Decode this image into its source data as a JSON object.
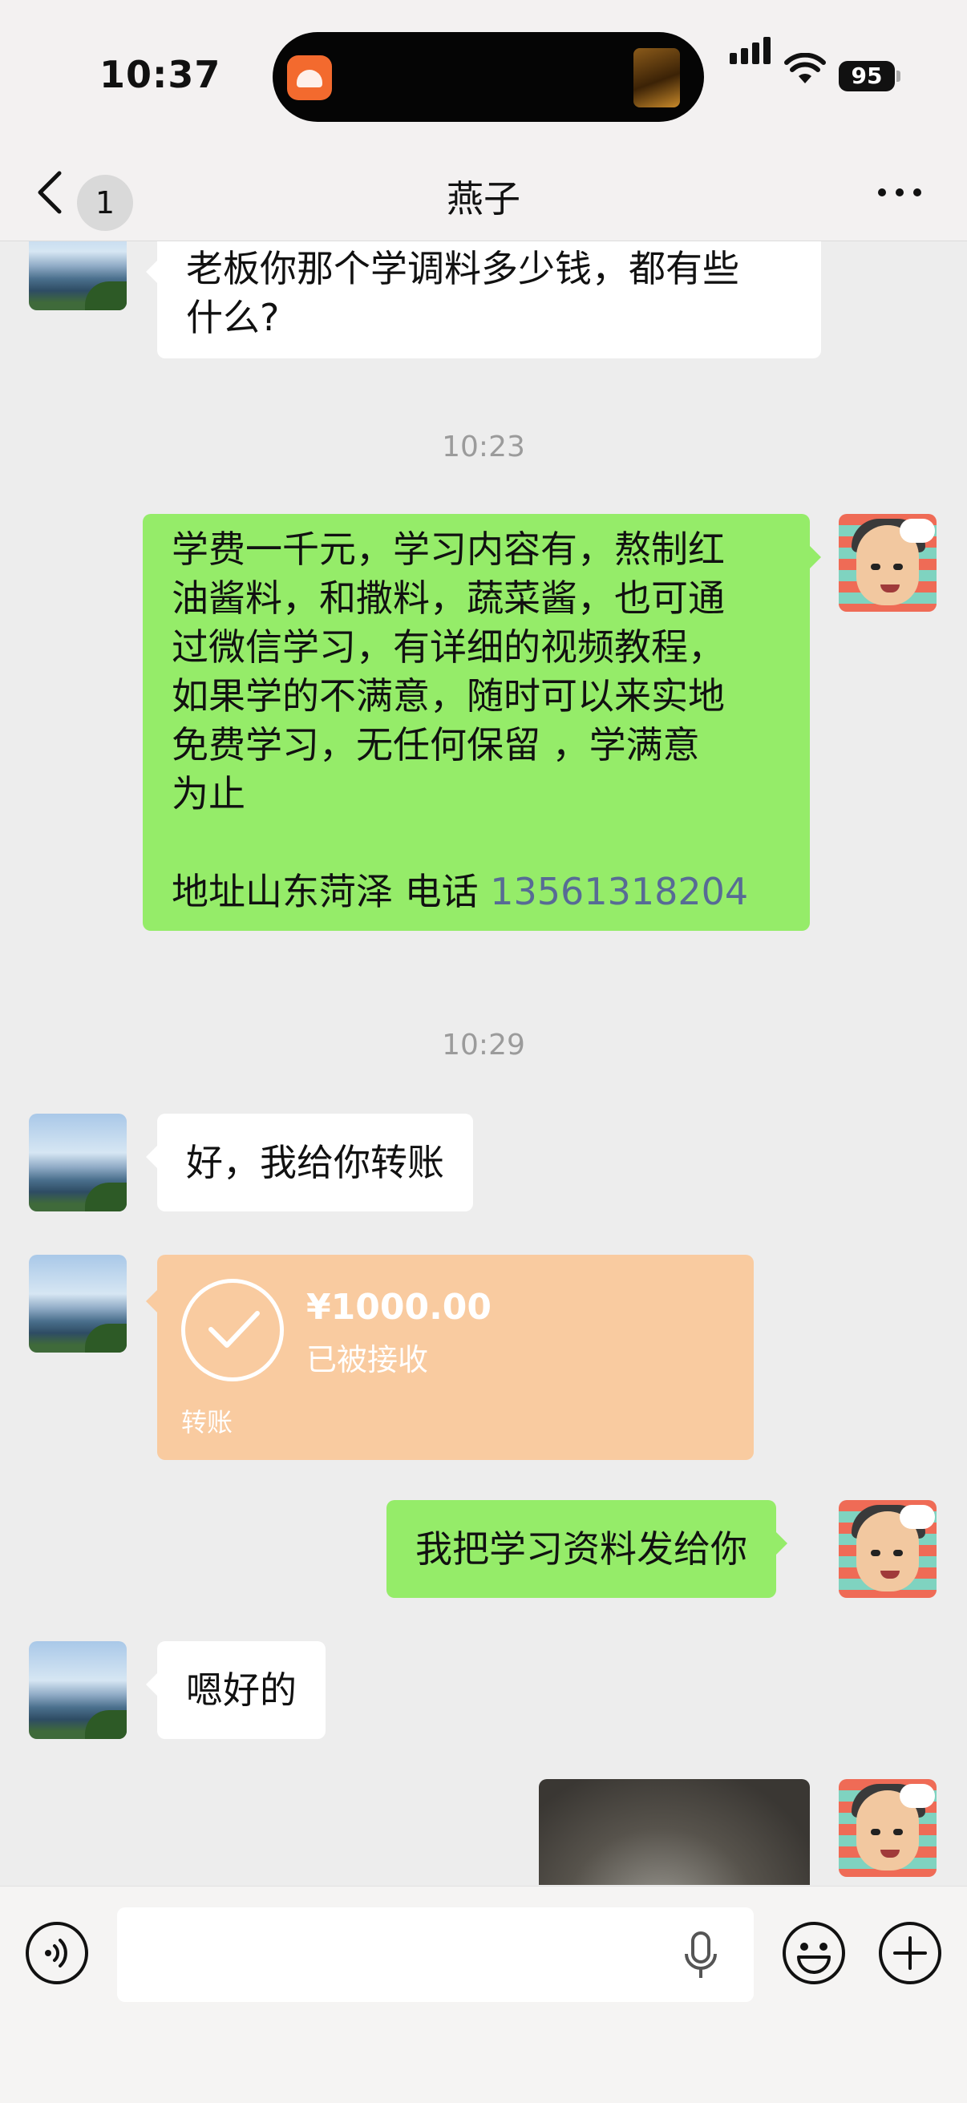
{
  "status_bar": {
    "time": "10:37",
    "battery": "95",
    "icons": [
      "signal-icon",
      "wifi-icon",
      "battery-icon"
    ]
  },
  "nav": {
    "back_badge": "1",
    "title": "燕子",
    "icons": [
      "chevron-left-icon",
      "more-icon"
    ]
  },
  "messages": {
    "m1": {
      "side": "in",
      "lines": [
        "老板你那个学调料多少钱，都有些",
        "什么?"
      ]
    },
    "ts1": "10:23",
    "m2": {
      "side": "out",
      "lines": [
        "学费一千元，学习内容有，熬制红",
        "油酱料，和撒料，蔬菜酱，也可通",
        "过微信学习，有详细的视频教程，",
        "如果学的不满意，随时可以来实地",
        "免费学习，无任何保留 ，学满意",
        "为止"
      ],
      "address": "地址山东菏泽 电话 ",
      "phone": "13561318204"
    },
    "ts2": "10:29",
    "m3": {
      "side": "in",
      "text": "好，我给你转账"
    },
    "m4": {
      "side": "in",
      "type": "transfer",
      "amount": "¥1000.00",
      "status": "已被接收",
      "label": "转账"
    },
    "m5": {
      "side": "out",
      "text": "我把学习资料发给你"
    },
    "m6": {
      "side": "in",
      "text": "嗯好的"
    },
    "m7": {
      "side": "out",
      "type": "image"
    }
  },
  "input_bar": {
    "placeholder": "",
    "icons": [
      "voice-icon",
      "microphone-icon",
      "emoji-icon",
      "plus-icon"
    ]
  },
  "colors": {
    "outgoing_bubble": "#95ec69",
    "incoming_bubble": "#ffffff",
    "transfer_card": "#f9cba0",
    "link": "#576b95",
    "background": "#ededed"
  }
}
